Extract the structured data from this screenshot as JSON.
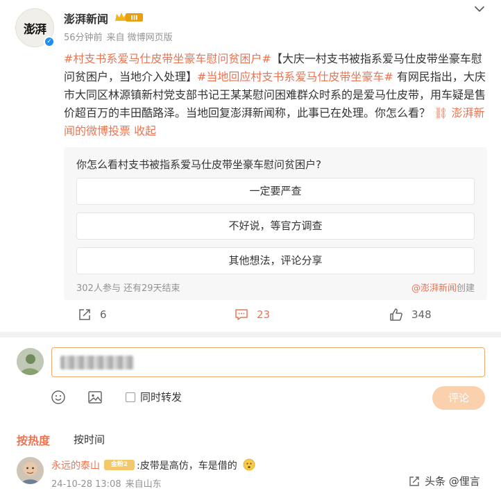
{
  "post": {
    "author": "澎湃新闻",
    "avatar_text": "澎湃",
    "vip_badge": "III",
    "time": "56分钟前",
    "source": "来自 微博网页版",
    "segments": [
      {
        "text": "#村支书系爱马仕皮带坐豪车慰问贫困户#",
        "kind": "tag"
      },
      {
        "text": "【大庆一村支书被指系爱马仕皮带坐豪车慰问贫困户，当地介入处理】",
        "kind": "plain"
      },
      {
        "text": "#当地回应村支书系爱马仕皮带坐豪车#",
        "kind": "tag"
      },
      {
        "text": " 有网民指出，大庆市大同区林源镇新村党支部书记王某某慰问困难群众时系的是爱马仕皮带，用车疑是售价超百万的丰田酷路泽。当地回复澎湃新闻称，此事已在处理。你怎么看？ ",
        "kind": "plain"
      },
      {
        "text": "澎湃新闻的微博投票",
        "kind": "link"
      },
      {
        "text": " 收起",
        "kind": "link"
      }
    ]
  },
  "poll": {
    "question": "你怎么看村支书被指系爱马仕皮带坐豪车慰问贫困户?",
    "options": [
      "一定要严查",
      "不好说，等官方调查",
      "其他想法，评论分享"
    ],
    "stats": "302人参与 还有29天结束",
    "creator": "@澎湃新闻",
    "creator_suffix": "创建"
  },
  "actions": {
    "repost_count": "6",
    "comment_count": "23",
    "like_count": "348"
  },
  "compose": {
    "also_repost": "同时转发",
    "submit": "评论"
  },
  "sort": {
    "hot": "按热度",
    "time": "按时间"
  },
  "comment": {
    "user": "永远的泰山",
    "badge": "金粉2",
    "text": ":皮带是高仿，车是借的",
    "timestamp": "24-10-28 13:08",
    "location": "来自山东"
  },
  "watermark": "头条 @俚言",
  "colors": {
    "accent": "#eb7350",
    "submit_bg": "#fad0ad",
    "verified": "#1e8ff0"
  }
}
